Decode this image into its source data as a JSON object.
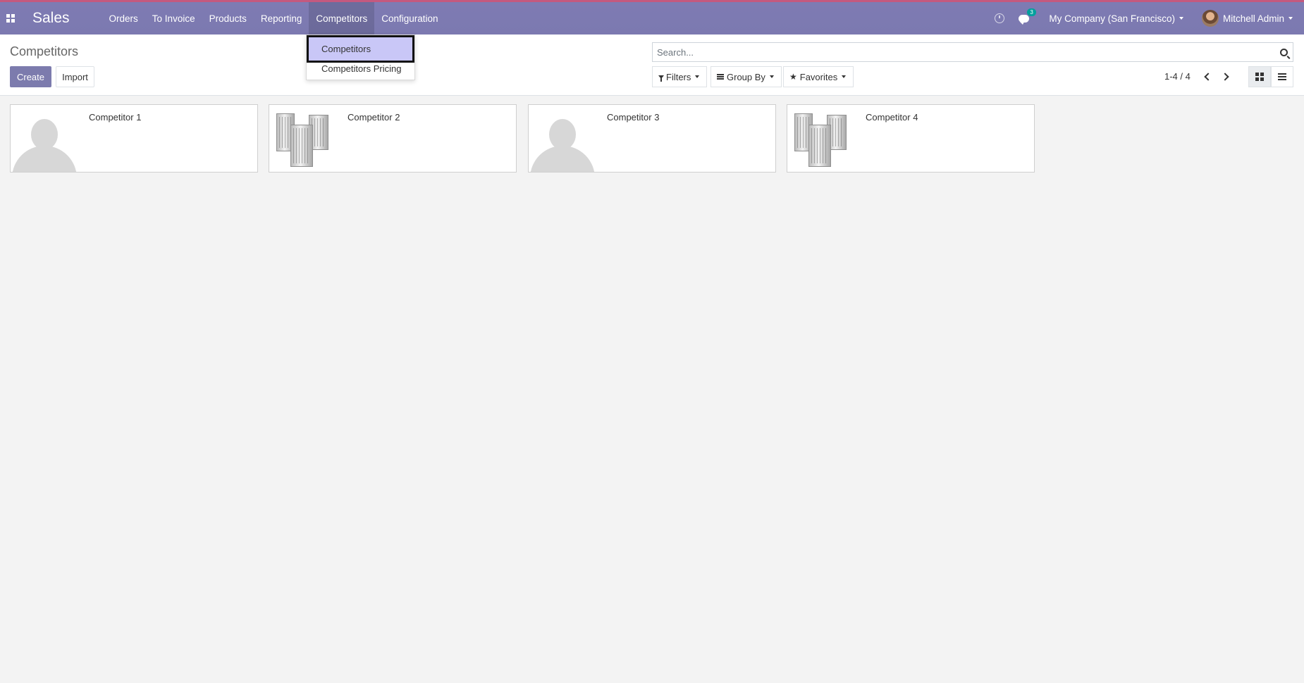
{
  "navbar": {
    "brand": "Sales",
    "menu": [
      {
        "label": "Orders"
      },
      {
        "label": "To Invoice"
      },
      {
        "label": "Products"
      },
      {
        "label": "Reporting"
      },
      {
        "label": "Competitors"
      },
      {
        "label": "Configuration"
      }
    ],
    "chat_count": "3",
    "company": "My Company (San Francisco)",
    "user": "Mitchell Admin",
    "color": "#7c79b0"
  },
  "dropdown": {
    "items": [
      {
        "label": "Competitors"
      },
      {
        "label": "Competitors Pricing"
      }
    ]
  },
  "control_panel": {
    "title": "Competitors",
    "create_label": "Create",
    "import_label": "Import",
    "search_placeholder": "Search...",
    "filters_label": "Filters",
    "groupby_label": "Group By",
    "favorites_label": "Favorites",
    "pager": "1-4 / 4"
  },
  "kanban": {
    "cards": [
      {
        "name": "Competitor 1",
        "image": "person-placeholder"
      },
      {
        "name": "Competitor 2",
        "image": "company-buildings"
      },
      {
        "name": "Competitor 3",
        "image": "person-placeholder"
      },
      {
        "name": "Competitor 4",
        "image": "company-buildings"
      }
    ]
  }
}
